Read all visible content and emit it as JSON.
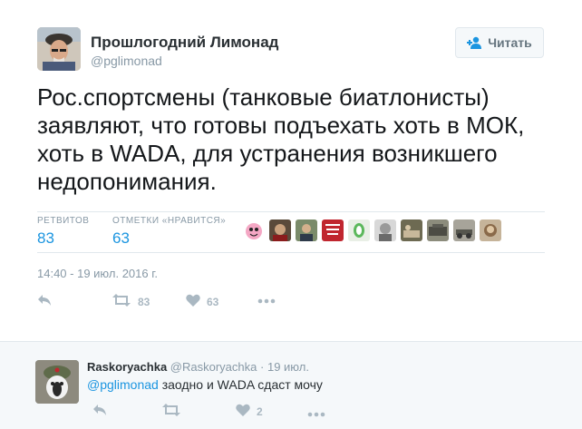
{
  "tweet": {
    "author_name": "Прошлогодний Лимонад",
    "author_handle": "@pglimonad",
    "follow_label": "Читать",
    "text": "Рос.спортсмены (танковые биатлонисты) заявляют, что готовы подъехать хоть в МОК, хоть в WADA, для устранения возникшего недопонимания.",
    "stats": {
      "retweets_label": "РЕТВИТОВ",
      "retweets_value": "83",
      "likes_label": "ОТМЕТКИ «НРАВИТСЯ»",
      "likes_value": "63"
    },
    "timestamp": "14:40 - 19 июл. 2016 г.",
    "actions": {
      "retweet_count": "83",
      "like_count": "63"
    }
  },
  "reply": {
    "author_name": "Raskoryachka",
    "author_handle": "@Raskoryachka",
    "separator": "·",
    "date": "19 июл.",
    "mention": "@pglimonad",
    "text": " заодно и WADA сдаст мочу",
    "like_count": "2"
  },
  "colors": {
    "link": "#1b95e0",
    "muted": "#8899a6",
    "icon": "#aab8c2"
  }
}
